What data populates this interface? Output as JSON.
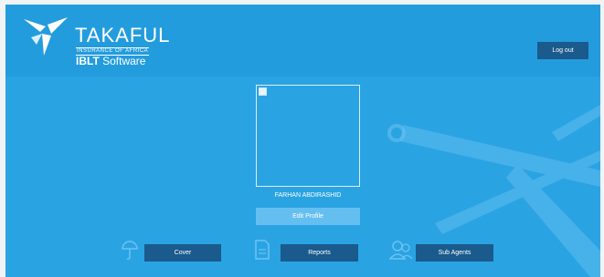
{
  "header": {
    "brand_name": "TAKAFUL",
    "brand_tagline": "INSURANCE OF AFRICA",
    "product_bold": "IBLT",
    "product_rest": " Software",
    "logout_label": "Log out"
  },
  "profile": {
    "user_name": "FARHAN ABDIRASHID",
    "edit_label": "Edit Profile"
  },
  "nav": {
    "cover_label": "Cover",
    "reports_label": "Reports",
    "sub_agents_label": "Sub Agents"
  },
  "colors": {
    "background": "#2aa3e3",
    "header": "#239cdd",
    "button_dark": "#1a5a8c",
    "button_light": "#64bff0"
  }
}
